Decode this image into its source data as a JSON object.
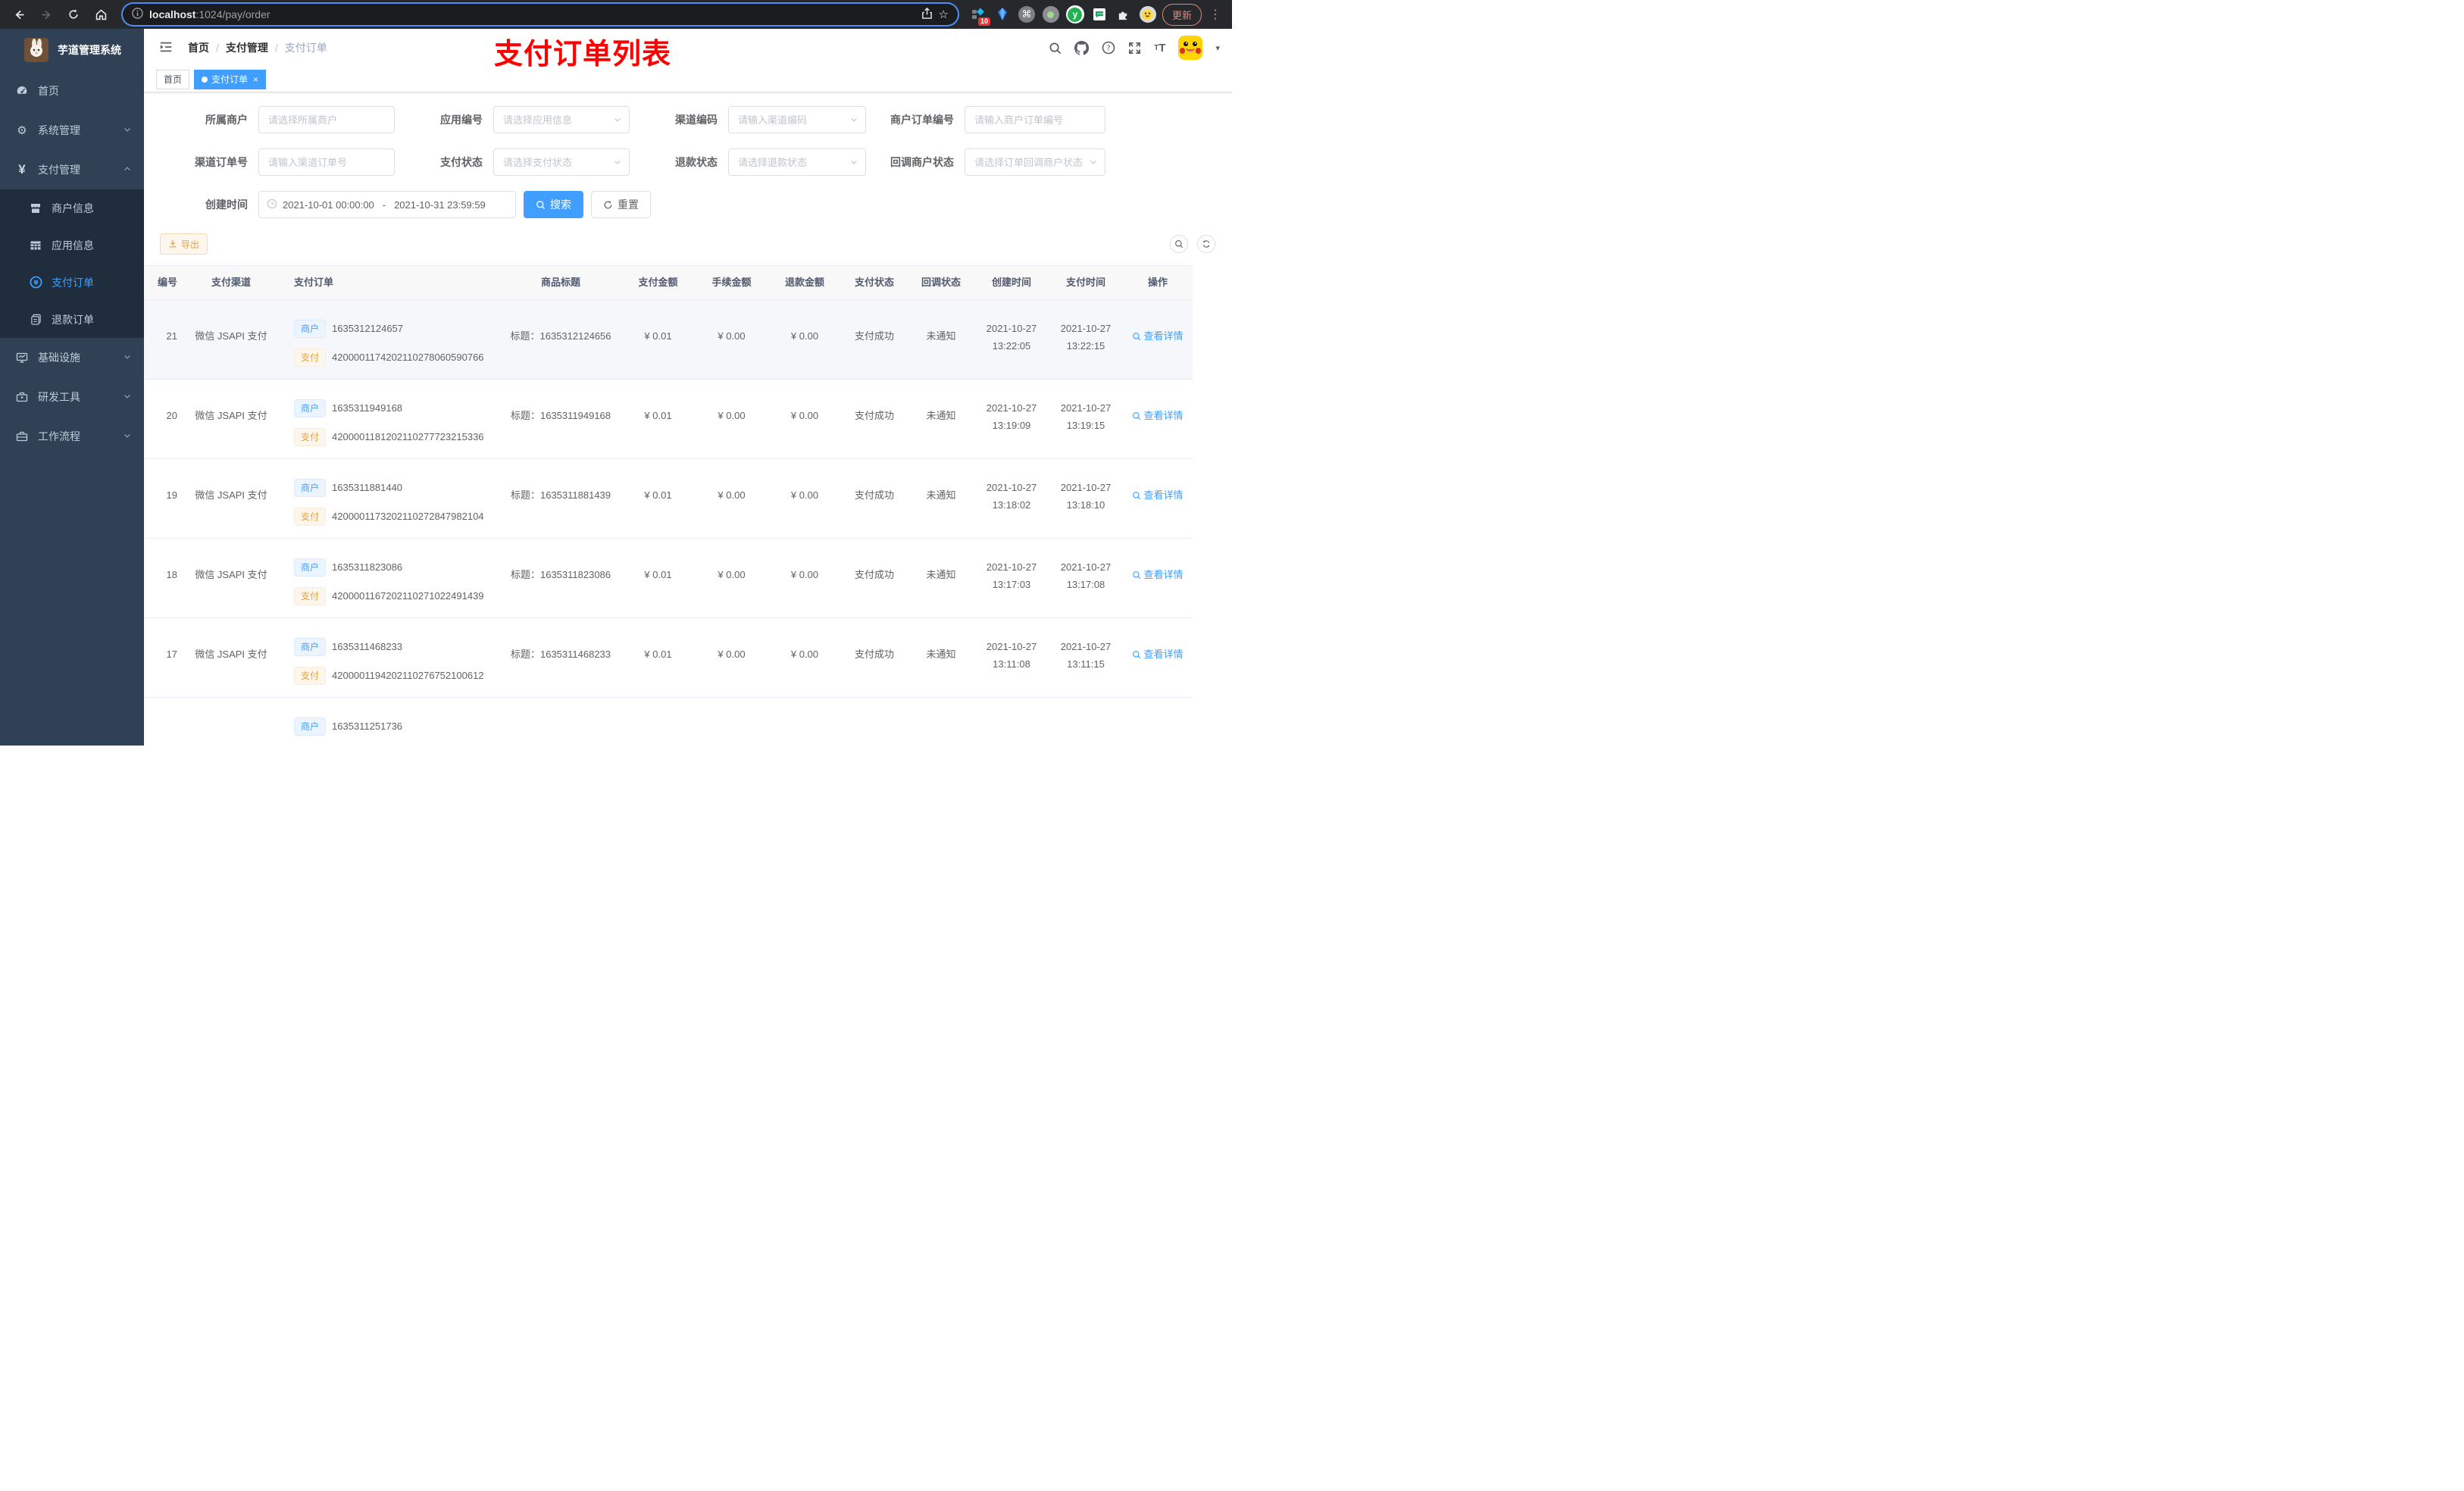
{
  "browser": {
    "url_host": "localhost",
    "url_rest": ":1024/pay/order",
    "extension_badge": "10",
    "update_label": "更新"
  },
  "sidebar": {
    "logo_title": "芋道管理系统",
    "menu_top": [
      {
        "label": "首页"
      },
      {
        "label": "系统管理"
      },
      {
        "label": "支付管理"
      }
    ],
    "submenu": [
      {
        "label": "商户信息"
      },
      {
        "label": "应用信息"
      },
      {
        "label": "支付订单"
      },
      {
        "label": "退款订单"
      }
    ],
    "menu_bottom": [
      {
        "label": "基础设施"
      },
      {
        "label": "研发工具"
      },
      {
        "label": "工作流程"
      }
    ]
  },
  "header": {
    "breadcrumb": [
      "首页",
      "支付管理",
      "支付订单"
    ],
    "separator": "/",
    "annotation": "支付订单列表"
  },
  "tabs": {
    "home": "首页",
    "active": "支付订单"
  },
  "filters": {
    "merchant": {
      "label": "所属商户",
      "placeholder": "请选择所属商户"
    },
    "app": {
      "label": "应用编号",
      "placeholder": "请选择应用信息"
    },
    "channel_code": {
      "label": "渠道编码",
      "placeholder": "请输入渠道编码"
    },
    "merchant_order_no": {
      "label": "商户订单编号",
      "placeholder": "请输入商户订单编号"
    },
    "channel_order_no": {
      "label": "渠道订单号",
      "placeholder": "请输入渠道订单号"
    },
    "pay_status": {
      "label": "支付状态",
      "placeholder": "请选择支付状态"
    },
    "refund_status": {
      "label": "退款状态",
      "placeholder": "请选择退款状态"
    },
    "notify_status": {
      "label": "回调商户状态",
      "placeholder": "请选择订单回调商户状态"
    },
    "create_time": {
      "label": "创建时间",
      "start": "2021-10-01 00:00:00",
      "separator": "-",
      "end": "2021-10-31 23:59:59"
    },
    "search_label": "搜索",
    "reset_label": "重置"
  },
  "toolbar": {
    "export_label": "导出"
  },
  "table": {
    "headers": [
      "编号",
      "支付渠道",
      "支付订单",
      "商品标题",
      "支付金额",
      "手续金额",
      "退款金额",
      "支付状态",
      "回调状态",
      "创建时间",
      "支付时间",
      "操作"
    ],
    "tag_merchant": "商户",
    "tag_pay": "支付",
    "title_prefix": "标题：",
    "action_label": "查看详情",
    "rows": [
      {
        "id": "21",
        "channel": "微信 JSAPI 支付",
        "merchant_no": "1635312124657",
        "pay_no": "4200001174202110278060590766",
        "title": "1635312124656",
        "amount": "¥ 0.01",
        "fee": "¥ 0.00",
        "refund": "¥ 0.00",
        "status": "支付成功",
        "notify": "未通知",
        "created_date": "2021-10-27",
        "created_time": "13:22:05",
        "paid_date": "2021-10-27",
        "paid_time": "13:22:15"
      },
      {
        "id": "20",
        "channel": "微信 JSAPI 支付",
        "merchant_no": "1635311949168",
        "pay_no": "4200001181202110277723215336",
        "title": "1635311949168",
        "amount": "¥ 0.01",
        "fee": "¥ 0.00",
        "refund": "¥ 0.00",
        "status": "支付成功",
        "notify": "未通知",
        "created_date": "2021-10-27",
        "created_time": "13:19:09",
        "paid_date": "2021-10-27",
        "paid_time": "13:19:15"
      },
      {
        "id": "19",
        "channel": "微信 JSAPI 支付",
        "merchant_no": "1635311881440",
        "pay_no": "4200001173202110272847982104",
        "title": "1635311881439",
        "amount": "¥ 0.01",
        "fee": "¥ 0.00",
        "refund": "¥ 0.00",
        "status": "支付成功",
        "notify": "未通知",
        "created_date": "2021-10-27",
        "created_time": "13:18:02",
        "paid_date": "2021-10-27",
        "paid_time": "13:18:10"
      },
      {
        "id": "18",
        "channel": "微信 JSAPI 支付",
        "merchant_no": "1635311823086",
        "pay_no": "4200001167202110271022491439",
        "title": "1635311823086",
        "amount": "¥ 0.01",
        "fee": "¥ 0.00",
        "refund": "¥ 0.00",
        "status": "支付成功",
        "notify": "未通知",
        "created_date": "2021-10-27",
        "created_time": "13:17:03",
        "paid_date": "2021-10-27",
        "paid_time": "13:17:08"
      },
      {
        "id": "17",
        "channel": "微信 JSAPI 支付",
        "merchant_no": "1635311468233",
        "pay_no": "4200001194202110276752100612",
        "title": "1635311468233",
        "amount": "¥ 0.01",
        "fee": "¥ 0.00",
        "refund": "¥ 0.00",
        "status": "支付成功",
        "notify": "未通知",
        "created_date": "2021-10-27",
        "created_time": "13:11:08",
        "paid_date": "2021-10-27",
        "paid_time": "13:11:15"
      },
      {
        "merchant_no": "1635311251736"
      }
    ]
  }
}
